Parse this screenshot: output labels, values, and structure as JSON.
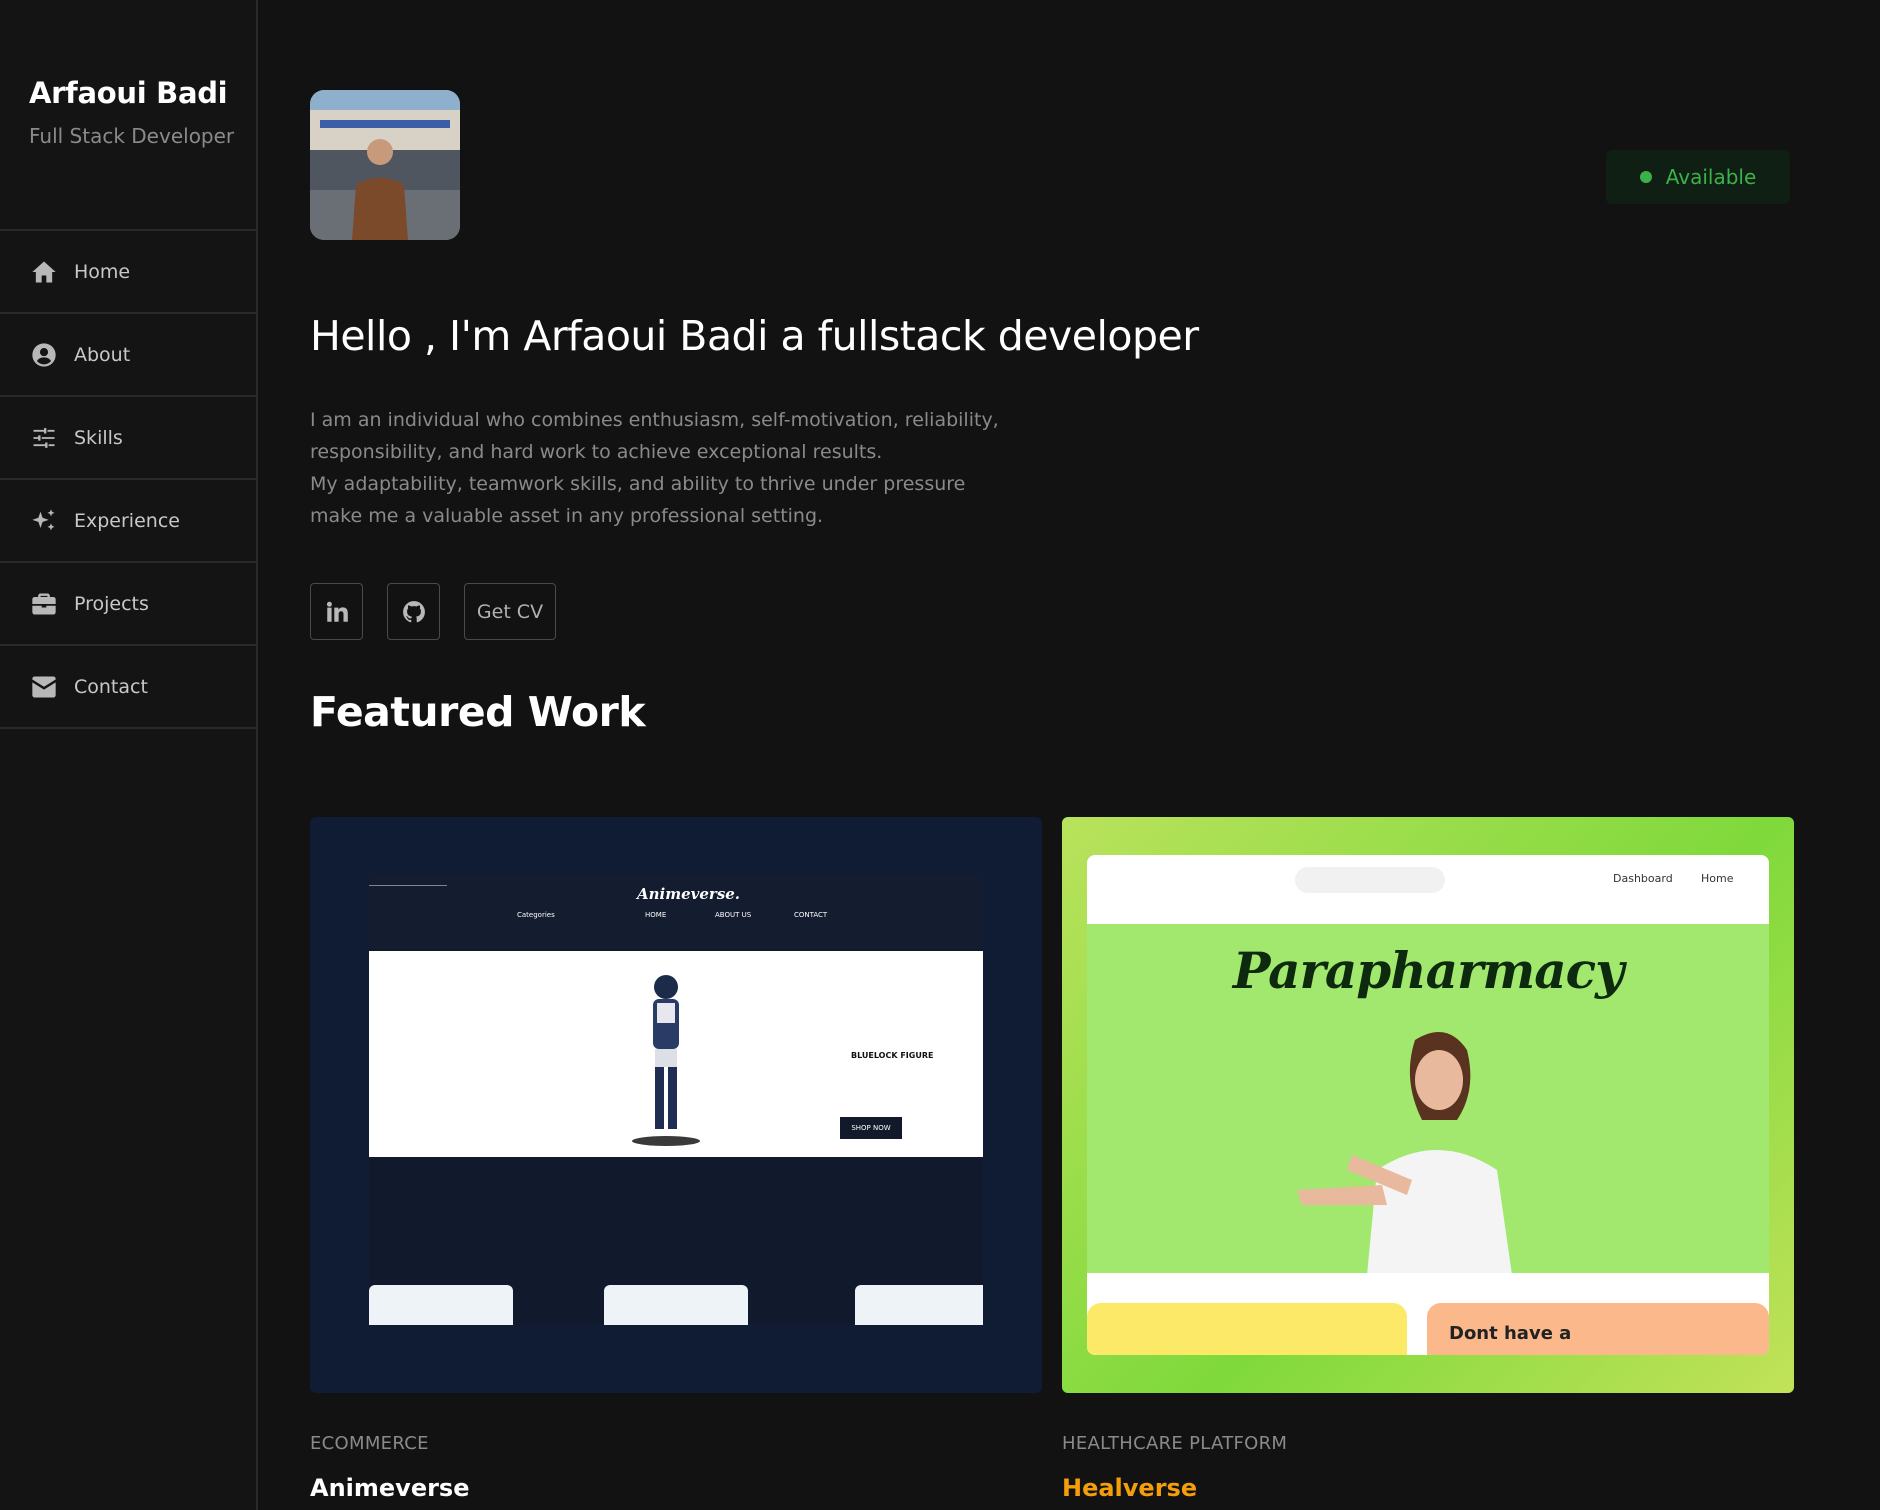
{
  "sidebar": {
    "name": "Arfaoui Badi",
    "role": "Full Stack Developer",
    "items": [
      {
        "label": "Home",
        "icon": "home-icon"
      },
      {
        "label": "About",
        "icon": "user-circle-icon"
      },
      {
        "label": "Skills",
        "icon": "sliders-icon"
      },
      {
        "label": "Experience",
        "icon": "sparkles-icon"
      },
      {
        "label": "Projects",
        "icon": "briefcase-icon"
      },
      {
        "label": "Contact",
        "icon": "envelope-icon"
      }
    ]
  },
  "status": {
    "label": "Available",
    "color": "#3bb14a"
  },
  "hero": {
    "headline": "Hello , I'm Arfaoui Badi a fullstack developer",
    "bio": [
      "I am an individual who combines enthusiasm, self-motivation, reliability,",
      "responsibility, and hard work to achieve exceptional results.",
      "My adaptability, teamwork skills, and ability to thrive under pressure",
      "make me a valuable asset in any professional setting."
    ]
  },
  "socials": {
    "linkedin_icon": "linkedin-icon",
    "github_icon": "github-icon",
    "cv_label": "Get CV"
  },
  "featured": {
    "title": "Featured Work",
    "projects": [
      {
        "category": "ECOMMERCE",
        "title": "Animeverse",
        "preview": {
          "logo": "Animeverse.",
          "categories": "Categories",
          "nav": [
            "HOME",
            "ABOUT US",
            "CONTACT"
          ],
          "hero_text": "BLUELOCK FIGURE",
          "cta": "SHOP NOW"
        }
      },
      {
        "category": "HEALTHCARE PLATFORM",
        "title": "Healverse",
        "preview": {
          "menu": [
            "Dashboard",
            "Home"
          ],
          "brand": "Parapharmacy",
          "banner_text": "Dont have a"
        }
      }
    ]
  },
  "colors": {
    "background": "#121212",
    "accent_orange": "#f59e0b",
    "status_green": "#3bb14a"
  }
}
